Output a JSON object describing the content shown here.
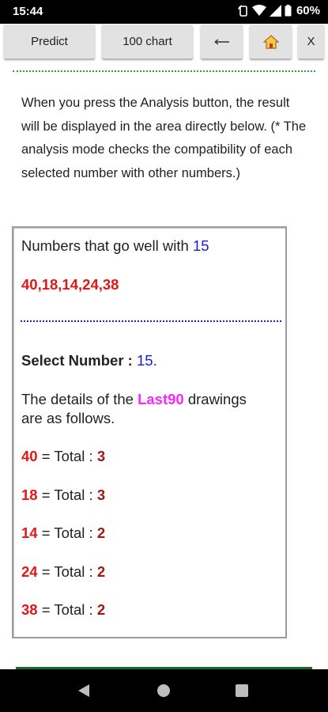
{
  "status_bar": {
    "time": "15:44",
    "battery": "60%"
  },
  "toolbar": {
    "predict_label": "Predict",
    "chart_label": "100 chart",
    "back_label": "⟵",
    "home_icon": "home-icon",
    "close_label": "X"
  },
  "intro_text": "When you press the Analysis button, the result will be displayed in the area directly below. (* The analysis mode checks the compatibility of each selected number with other numbers.)",
  "result": {
    "goes_well_prefix": "Numbers that go well with",
    "selected_number": "15",
    "good_numbers": "40,18,14,24,38",
    "select_label": "Select Number :",
    "select_value": "15",
    "select_suffix": ".",
    "details_prefix": "The details of the",
    "details_highlight": "Last90",
    "details_suffix": "drawings",
    "details_line2": "are as follows.",
    "totals_label": "= Total :",
    "rows": [
      {
        "number": "40",
        "total": "3"
      },
      {
        "number": "18",
        "total": "3"
      },
      {
        "number": "14",
        "total": "2"
      },
      {
        "number": "24",
        "total": "2"
      },
      {
        "number": "38",
        "total": "2"
      }
    ]
  },
  "colors": {
    "accent_blue": "#1a1ae6",
    "number_red": "#e01818",
    "highlight_magenta": "#ff26ff",
    "divider_green": "#2e9e3e"
  }
}
